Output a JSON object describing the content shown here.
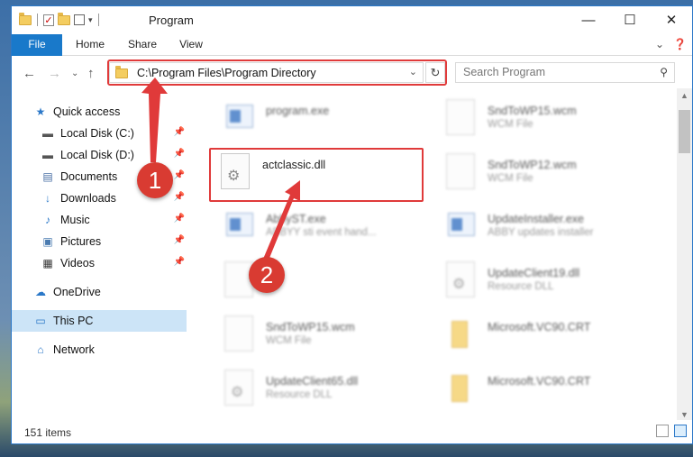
{
  "window": {
    "title": "Program",
    "controls": {
      "minimize": "—",
      "maximize": "☐",
      "close": "✕"
    }
  },
  "ribbon": {
    "tabs": [
      "File",
      "Home",
      "Share",
      "View"
    ],
    "right_icons": [
      "chevron-down-icon",
      "help-icon"
    ]
  },
  "address_bar": {
    "path": "C:\\Program Files\\Program Directory",
    "search_placeholder": "Search Program"
  },
  "nav_pane": {
    "items": [
      {
        "label": "Quick access",
        "icon": "star-icon",
        "pinned": false
      },
      {
        "label": "Local Disk (C:)",
        "icon": "drive-icon",
        "pinned": true
      },
      {
        "label": "Local Disk (D:)",
        "icon": "drive-icon",
        "pinned": true
      },
      {
        "label": "Documents",
        "icon": "documents-icon",
        "pinned": true
      },
      {
        "label": "Downloads",
        "icon": "download-icon",
        "pinned": true
      },
      {
        "label": "Music",
        "icon": "music-icon",
        "pinned": true
      },
      {
        "label": "Pictures",
        "icon": "pictures-icon",
        "pinned": true
      },
      {
        "label": "Videos",
        "icon": "videos-icon",
        "pinned": true
      },
      {
        "label": "OneDrive",
        "icon": "cloud-icon",
        "pinned": false
      },
      {
        "label": "This PC",
        "icon": "computer-icon",
        "pinned": false,
        "selected": true
      },
      {
        "label": "Network",
        "icon": "network-icon",
        "pinned": false
      }
    ]
  },
  "files": [
    {
      "name": "program.exe",
      "type": "",
      "icon": "exe"
    },
    {
      "name": "SndToWP15.wcm",
      "type": "WCM File",
      "icon": "blank"
    },
    {
      "name": "actclassic.dll",
      "type": "",
      "icon": "gear"
    },
    {
      "name": "SndToWP12.wcm",
      "type": "WCM File",
      "icon": "blank"
    },
    {
      "name": "AbbyST.exe",
      "type": "ABBYY sti event hand...",
      "icon": "exe"
    },
    {
      "name": "UpdateInstaller.exe",
      "type": "ABBY updates installer",
      "icon": "exe"
    },
    {
      "name": "",
      "type": "",
      "icon": "blank"
    },
    {
      "name": "UpdateClient19.dll",
      "type": "Resource DLL",
      "icon": "gear"
    },
    {
      "name": "SndToWP15.wcm",
      "type": "WCM File",
      "icon": "blank"
    },
    {
      "name": "Microsoft.VC90.CRT",
      "type": "",
      "icon": "folder"
    },
    {
      "name": "UpdateClient65.dll",
      "type": "Resource DLL",
      "icon": "gear"
    },
    {
      "name": "Microsoft.VC90.CRT",
      "type": "",
      "icon": "folder"
    }
  ],
  "status": {
    "item_count": "151 items"
  },
  "annotations": {
    "step1": "1",
    "step2": "2",
    "color": "#e03a3a"
  }
}
